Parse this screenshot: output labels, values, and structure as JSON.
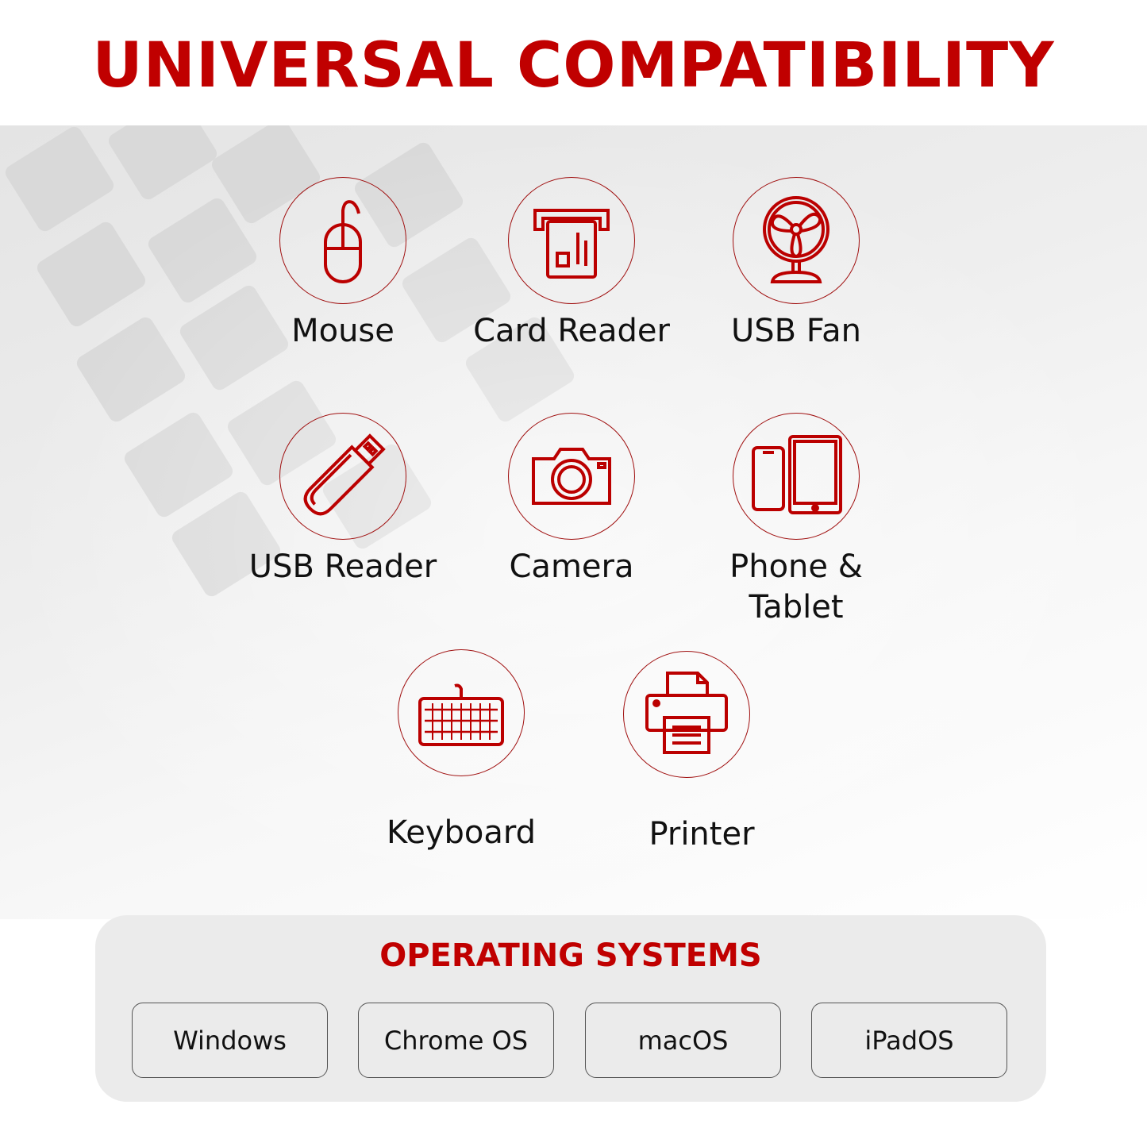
{
  "title": "UNIVERSAL COMPATIBILITY",
  "accent_color": "#c00000",
  "devices": [
    {
      "label": "Mouse",
      "icon": "mouse-icon"
    },
    {
      "label": "Card Reader",
      "icon": "card-reader-icon"
    },
    {
      "label": "USB Fan",
      "icon": "fan-icon"
    },
    {
      "label": "USB Reader",
      "icon": "usb-drive-icon"
    },
    {
      "label": "Camera",
      "icon": "camera-icon"
    },
    {
      "label_line1": "Phone &",
      "label_line2": "Tablet",
      "icon": "phone-tablet-icon"
    },
    {
      "label": "Keyboard",
      "icon": "keyboard-icon"
    },
    {
      "label": "Printer",
      "icon": "printer-icon"
    }
  ],
  "os_panel": {
    "heading": "OPERATING SYSTEMS",
    "systems": [
      "Windows",
      "Chrome OS",
      "macOS",
      "iPadOS"
    ]
  }
}
